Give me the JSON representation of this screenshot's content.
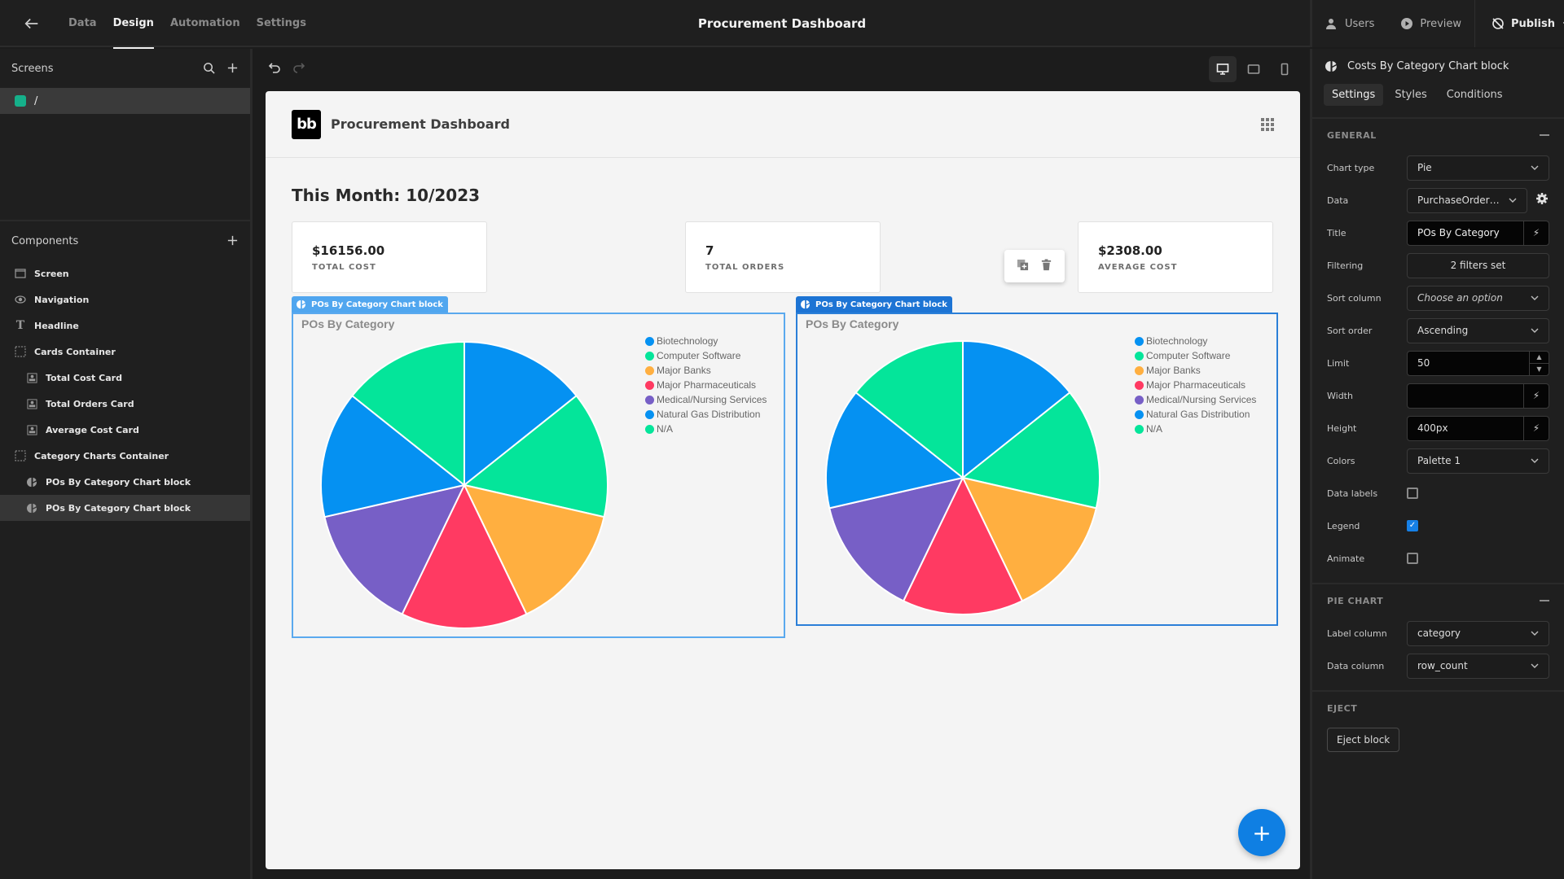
{
  "topbar": {
    "tabs": [
      {
        "label": "Data",
        "active": false
      },
      {
        "label": "Design",
        "active": true
      },
      {
        "label": "Automation",
        "active": false
      },
      {
        "label": "Settings",
        "active": false
      }
    ],
    "title": "Procurement Dashboard",
    "users_label": "Users",
    "preview_label": "Preview",
    "publish_label": "Publish"
  },
  "left": {
    "screens_title": "Screens",
    "screen_route": "/",
    "screen_color": "#15b08a",
    "components_title": "Components",
    "components": [
      {
        "label": "Screen",
        "icon": "screen-icon",
        "level": 1
      },
      {
        "label": "Navigation",
        "icon": "eye-icon",
        "level": 1
      },
      {
        "label": "Headline",
        "icon": "text-icon",
        "level": 1
      },
      {
        "label": "Cards Container",
        "icon": "container-icon",
        "level": 1
      },
      {
        "label": "Total Cost Card",
        "icon": "card-icon",
        "level": 2
      },
      {
        "label": "Total Orders Card",
        "icon": "card-icon",
        "level": 2
      },
      {
        "label": "Average Cost Card",
        "icon": "card-icon",
        "level": 2
      },
      {
        "label": "Category Charts Container",
        "icon": "container-icon",
        "level": 1
      },
      {
        "label": "POs By Category Chart block",
        "icon": "pie-chart-icon",
        "level": 2
      },
      {
        "label": "POs By Category Chart block",
        "icon": "pie-chart-icon",
        "level": 2,
        "selected": true
      }
    ]
  },
  "page": {
    "nav_title": "Procurement Dashboard",
    "logo_text": "bb",
    "headline": "This Month: 10/2023",
    "cards": [
      {
        "value": "$16156.00",
        "label": "TOTAL COST"
      },
      {
        "value": "7",
        "label": "TOTAL ORDERS"
      },
      {
        "value": "$2308.00",
        "label": "AVERAGE COST"
      }
    ],
    "chart_tag_label": "POs By Category Chart block"
  },
  "chart_data": [
    {
      "type": "pie",
      "title": "POs By Category",
      "categories": [
        "Biotechnology",
        "Computer Software",
        "Major Banks",
        "Major Pharmaceuticals",
        "Medical/Nursing Services",
        "Natural Gas Distribution",
        "N/A"
      ],
      "values": [
        1,
        1,
        1,
        1,
        1,
        1,
        1
      ],
      "colors": [
        "#0591f2",
        "#04e59a",
        "#ffaf40",
        "#ff3a62",
        "#775fc6",
        "#0591f2",
        "#04e59a"
      ],
      "legend": "top-right",
      "data_labels": false
    },
    {
      "type": "pie",
      "title": "POs By Category",
      "categories": [
        "Biotechnology",
        "Computer Software",
        "Major Banks",
        "Major Pharmaceuticals",
        "Medical/Nursing Services",
        "Natural Gas Distribution",
        "N/A"
      ],
      "values": [
        1,
        1,
        1,
        1,
        1,
        1,
        1
      ],
      "colors": [
        "#0591f2",
        "#04e59a",
        "#ffaf40",
        "#ff3a62",
        "#775fc6",
        "#0591f2",
        "#04e59a"
      ],
      "legend": "top-right",
      "data_labels": false
    }
  ],
  "right": {
    "block_name": "Costs By Category Chart block",
    "tabs": [
      {
        "label": "Settings",
        "active": true
      },
      {
        "label": "Styles",
        "active": false
      },
      {
        "label": "Conditions",
        "active": false
      }
    ],
    "general_title": "GENERAL",
    "chart_type_label": "Chart type",
    "chart_type_value": "Pie",
    "data_label": "Data",
    "data_value": "PurchaseOrder…",
    "title_label": "Title",
    "title_value": "POs By Category",
    "filtering_label": "Filtering",
    "filtering_value": "2 filters set",
    "sort_column_label": "Sort column",
    "sort_column_placeholder": "Choose an option",
    "sort_order_label": "Sort order",
    "sort_order_value": "Ascending",
    "limit_label": "Limit",
    "limit_value": "50",
    "width_label": "Width",
    "width_value": "",
    "height_label": "Height",
    "height_value": "400px",
    "colors_label": "Colors",
    "colors_value": "Palette 1",
    "data_labels_label": "Data labels",
    "data_labels_checked": false,
    "legend_label": "Legend",
    "legend_checked": true,
    "animate_label": "Animate",
    "animate_checked": false,
    "pie_title": "PIE CHART",
    "label_column_label": "Label column",
    "label_column_value": "category",
    "data_column_label": "Data column",
    "data_column_value": "row_count",
    "eject_title": "EJECT",
    "eject_button": "Eject block"
  }
}
